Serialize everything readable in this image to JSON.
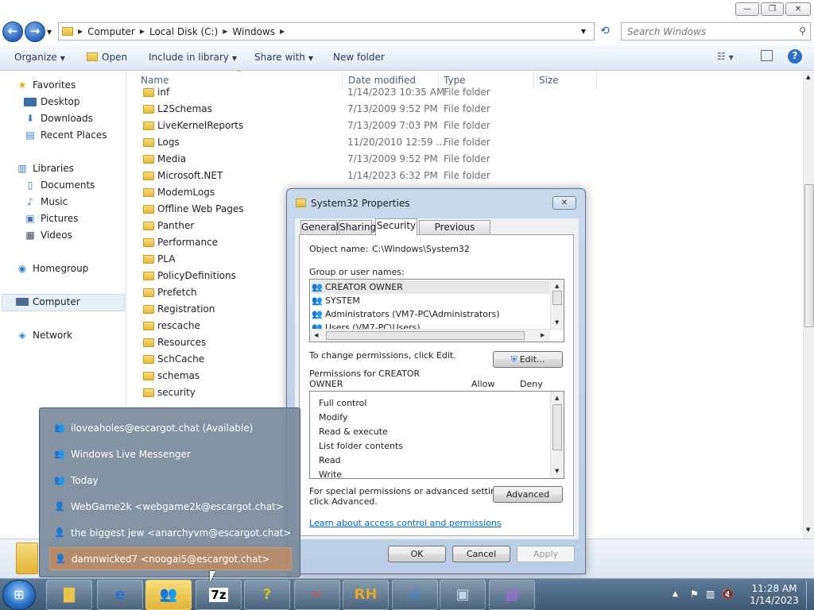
{
  "window": {
    "min_label": "—",
    "max_label": "❐",
    "close_label": "✕"
  },
  "address": {
    "crumbs": [
      "Computer",
      "Local Disk (C:)",
      "Windows"
    ],
    "search_placeholder": "Search Windows"
  },
  "toolbar": {
    "organize": "Organize",
    "open": "Open",
    "include": "Include in library",
    "share": "Share with",
    "new_folder": "New folder"
  },
  "nav": {
    "favorites": "Favorites",
    "desktop": "Desktop",
    "downloads": "Downloads",
    "recent": "Recent Places",
    "libraries": "Libraries",
    "documents": "Documents",
    "music": "Music",
    "pictures": "Pictures",
    "videos": "Videos",
    "homegroup": "Homegroup",
    "computer": "Computer",
    "network": "Network"
  },
  "columns": {
    "name": "Name",
    "date": "Date modified",
    "type": "Type",
    "size": "Size"
  },
  "files": [
    {
      "name": "inf",
      "date": "1/14/2023 10:35 AM",
      "type": "File folder"
    },
    {
      "name": "L2Schemas",
      "date": "7/13/2009 9:52 PM",
      "type": "File folder"
    },
    {
      "name": "LiveKernelReports",
      "date": "7/13/2009 7:03 PM",
      "type": "File folder"
    },
    {
      "name": "Logs",
      "date": "11/20/2010 12:59 ...",
      "type": "File folder"
    },
    {
      "name": "Media",
      "date": "7/13/2009 9:52 PM",
      "type": "File folder"
    },
    {
      "name": "Microsoft.NET",
      "date": "1/14/2023 6:32 PM",
      "type": "File folder"
    },
    {
      "name": "ModemLogs",
      "date": "",
      "type": ""
    },
    {
      "name": "Offline Web Pages",
      "date": "",
      "type": ""
    },
    {
      "name": "Panther",
      "date": "",
      "type": ""
    },
    {
      "name": "Performance",
      "date": "",
      "type": ""
    },
    {
      "name": "PLA",
      "date": "",
      "type": ""
    },
    {
      "name": "PolicyDefinitions",
      "date": "",
      "type": ""
    },
    {
      "name": "Prefetch",
      "date": "",
      "type": ""
    },
    {
      "name": "Registration",
      "date": "",
      "type": ""
    },
    {
      "name": "rescache",
      "date": "",
      "type": ""
    },
    {
      "name": "Resources",
      "date": "",
      "type": ""
    },
    {
      "name": "SchCache",
      "date": "",
      "type": ""
    },
    {
      "name": "schemas",
      "date": "",
      "type": ""
    },
    {
      "name": "security",
      "date": "",
      "type": ""
    }
  ],
  "dialog": {
    "title": "System32 Properties",
    "tabs": [
      "General",
      "Sharing",
      "Security",
      "Previous Versions"
    ],
    "object_label": "Object name:",
    "object_value": "C:\\Windows\\System32",
    "group_label": "Group or user names:",
    "users": [
      "CREATOR OWNER",
      "SYSTEM",
      "Administrators (VM7-PC\\Administrators)",
      "Users (VM7-PC\\Users)"
    ],
    "change_text": "To change permissions, click Edit.",
    "edit_btn": "Edit...",
    "perm_label_1": "Permissions for CREATOR",
    "perm_label_2": "OWNER",
    "allow": "Allow",
    "deny": "Deny",
    "permissions": [
      "Full control",
      "Modify",
      "Read & execute",
      "List folder contents",
      "Read",
      "Write"
    ],
    "special_1": "For special permissions or advanced settings,",
    "special_2": "click Advanced.",
    "advanced_btn": "Advanced",
    "learn_link": "Learn about access control and permissions",
    "ok": "OK",
    "cancel": "Cancel",
    "apply": "Apply"
  },
  "jumplist": [
    "iloveaholes@escargot.chat (Available)",
    "Windows Live Messenger",
    "Today",
    "WebGame2k <webgame2k@escargot.chat>",
    "the biggest jew <anarchyvm@escargot.chat>",
    "damnwicked7 <noogai5@escargot.chat>"
  ],
  "taskbar": {
    "apps": [
      "explorer",
      "ie",
      "messenger",
      "7z",
      "help",
      "paint",
      "rh",
      "chrome",
      "network",
      "installer"
    ],
    "app_labels": {
      "z7": "7z",
      "rh": "RH"
    },
    "time": "11:28 AM",
    "date": "1/14/2023"
  }
}
